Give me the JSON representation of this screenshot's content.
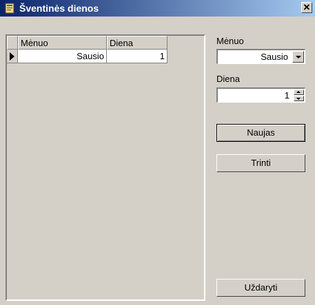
{
  "window": {
    "title": "Šventinės dienos",
    "close": "✕"
  },
  "grid": {
    "columns": [
      "Mėnuo",
      "Diena"
    ],
    "rows": [
      {
        "month": "Sausio",
        "day": "1"
      }
    ]
  },
  "form": {
    "month_label": "Mėnuo",
    "month_value": "Sausio",
    "day_label": "Diena",
    "day_value": "1"
  },
  "buttons": {
    "new": "Naujas",
    "delete": "Trinti",
    "close": "Uždaryti"
  }
}
